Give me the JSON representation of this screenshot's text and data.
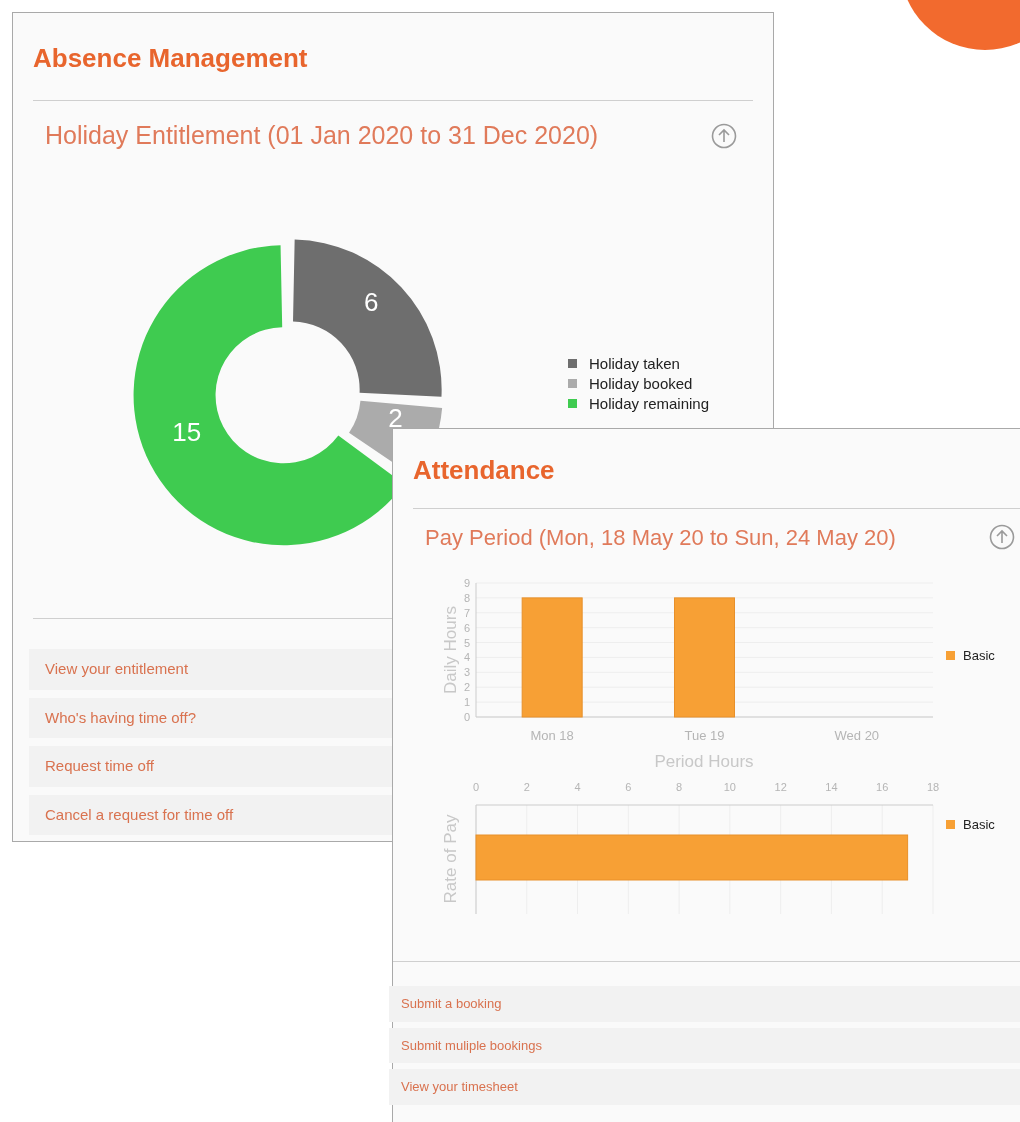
{
  "panels": [
    {
      "kind": "donut",
      "title": "Absence Management",
      "subtitle": "Holiday Entitlement (01 Jan 2020 to 31 Dec 2020)",
      "chart_data": {
        "type": "donut",
        "categories": [
          "Holiday taken",
          "Holiday booked",
          "Holiday remaining"
        ],
        "values": [
          6,
          2,
          15
        ],
        "colors": [
          "#6e6e6e",
          "#ababab",
          "#3fcb50"
        ],
        "data_labels": true,
        "legend": true
      },
      "links": [
        "View your entitlement",
        "Who's having time off?",
        "Request time off",
        "Cancel a request for time off"
      ]
    },
    {
      "kind": "bars",
      "title": "Attendance",
      "subtitle": "Pay Period (Mon, 18 May 20 to Sun, 24 May 20)",
      "charts": [
        {
          "chart_data": {
            "type": "bar",
            "orientation": "vertical",
            "ylabel": "Daily Hours",
            "categories": [
              "Mon 18",
              "Tue 19",
              "Wed 20"
            ],
            "series": [
              {
                "name": "Basic",
                "color": "#f7a035",
                "values": [
                  8,
                  8,
                  0
                ]
              }
            ],
            "ylim": [
              0,
              9
            ],
            "yticks": [
              0,
              1,
              2,
              3,
              4,
              5,
              6,
              7,
              8,
              9
            ],
            "grid": true
          }
        },
        {
          "chart_data": {
            "type": "bar",
            "orientation": "horizontal",
            "xlabel": "Period Hours",
            "ylabel": "Rate of Pay",
            "series": [
              {
                "name": "Basic",
                "color": "#f7a035",
                "values": [
                  17
                ]
              }
            ],
            "xlim": [
              0,
              18
            ],
            "xticks": [
              0,
              2,
              4,
              6,
              8,
              10,
              12,
              14,
              16,
              18
            ],
            "grid": true
          }
        }
      ],
      "links": [
        "Submit a booking",
        "Submit muliple bookings",
        "View your timesheet"
      ]
    }
  ]
}
